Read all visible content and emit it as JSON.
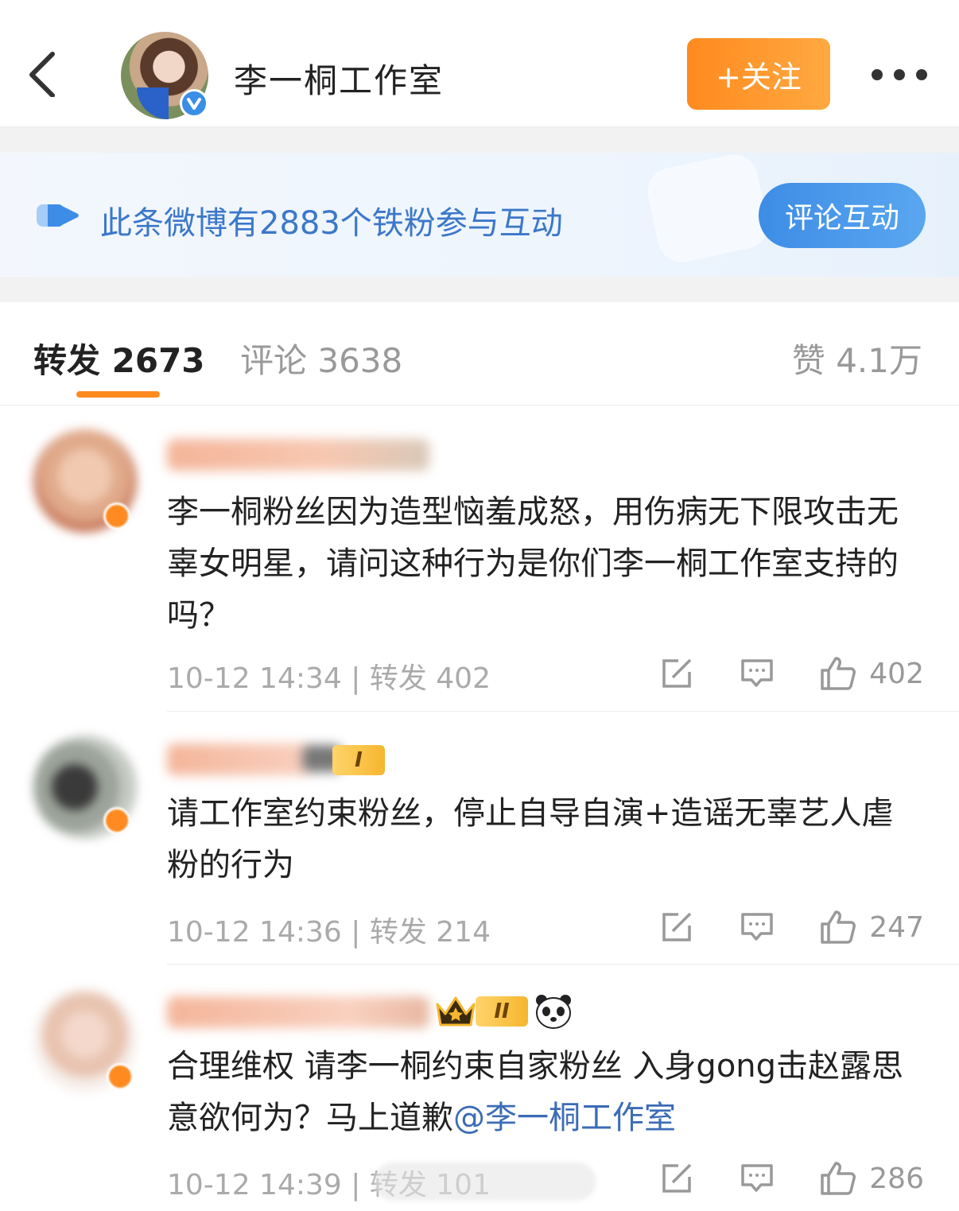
{
  "header": {
    "title": "李一桐工作室",
    "follow_label": "+关注",
    "icons": {
      "back": "chevron-left-icon",
      "more": "more-dots-icon",
      "verified": "verified-v-icon"
    }
  },
  "banner": {
    "text": "此条微博有2883个铁粉参与互动",
    "button_label": "评论互动"
  },
  "tabs": {
    "repost": "转发 2673",
    "comment": "评论 3638",
    "like": "赞 4.1万",
    "active": "repost"
  },
  "comments": [
    {
      "text": "李一桐粉丝因为造型恼羞成怒，用伤病无下限攻击无辜女明星，请问这种行为是你们李一桐工作室支持的吗？",
      "meta": "10-12 14:34 | 转发 402",
      "likes": "402"
    },
    {
      "text": "请工作室约束粉丝，停止自导自演+造谣无辜艺人虐粉的行为",
      "meta": "10-12 14:36 | 转发 214",
      "likes": "247",
      "level_badge": "I"
    },
    {
      "text_before_mention": "合理维权 请李一桐约束自家粉丝 入身gong击赵露思意欲何为？马上道歉",
      "mention": "@李一桐工作室",
      "meta": "10-12 14:39 | 转发 101",
      "likes": "286",
      "level_badge": "II"
    }
  ],
  "colors": {
    "accent_orange": "#ff8a1f",
    "accent_blue": "#3d8de6",
    "banner_text": "#3b78c9",
    "mention": "#3b6cb5"
  }
}
